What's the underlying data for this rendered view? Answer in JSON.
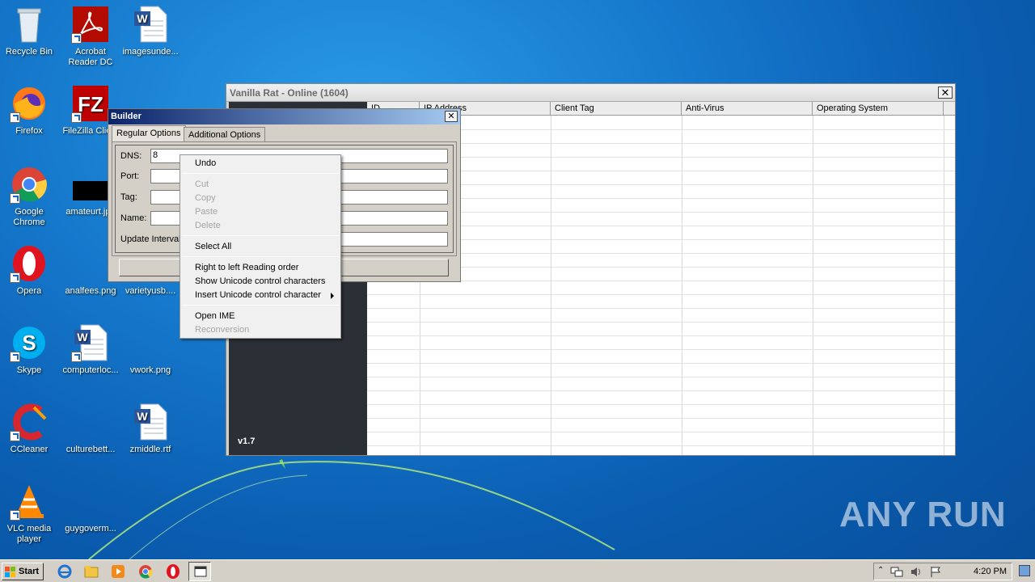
{
  "desktop": {
    "icons": [
      {
        "label": "Recycle Bin"
      },
      {
        "label": "Acrobat Reader DC"
      },
      {
        "label": "imagesunde..."
      },
      {
        "label": "Firefox"
      },
      {
        "label": "FileZilla Clie..."
      },
      {
        "label": "Google Chrome"
      },
      {
        "label": "amateurt.jpg"
      },
      {
        "label": "Opera"
      },
      {
        "label": "analfees.png"
      },
      {
        "label": "varietyusb...."
      },
      {
        "label": "Skype"
      },
      {
        "label": "computerloc..."
      },
      {
        "label": "vwork.png"
      },
      {
        "label": "CCleaner"
      },
      {
        "label": "culturebett..."
      },
      {
        "label": "zmiddle.rtf"
      },
      {
        "label": "VLC media player"
      },
      {
        "label": "guygoverm..."
      }
    ]
  },
  "rat_window": {
    "title": "Vanilla Rat - Online (1604)",
    "close_label": "✕",
    "version": "v1.7",
    "columns": [
      "ID",
      "IP Address",
      "Client Tag",
      "Anti-Virus",
      "Operating System"
    ]
  },
  "builder": {
    "title": "Builder",
    "close_label": "✕",
    "tabs": [
      "Regular Options",
      "Additional Options"
    ],
    "fields": {
      "dns_label": "DNS:",
      "dns_value": "8",
      "port_label": "Port:",
      "tag_label": "Tag:",
      "name_label": "Name:",
      "interval_label": "Update Interval"
    }
  },
  "context_menu": {
    "items": [
      {
        "label": "Undo",
        "enabled": true
      },
      {
        "label": "Cut",
        "enabled": false
      },
      {
        "label": "Copy",
        "enabled": false
      },
      {
        "label": "Paste",
        "enabled": false
      },
      {
        "label": "Delete",
        "enabled": false
      },
      {
        "label": "Select All",
        "enabled": true
      },
      {
        "label": "Right to left Reading order",
        "enabled": true
      },
      {
        "label": "Show Unicode control characters",
        "enabled": true
      },
      {
        "label": "Insert Unicode control character",
        "enabled": true
      },
      {
        "label": "Open IME",
        "enabled": true
      },
      {
        "label": "Reconversion",
        "enabled": false
      }
    ]
  },
  "watermark": "ANY RUN",
  "taskbar": {
    "start_label": "Start",
    "clock": "4:20 PM"
  }
}
